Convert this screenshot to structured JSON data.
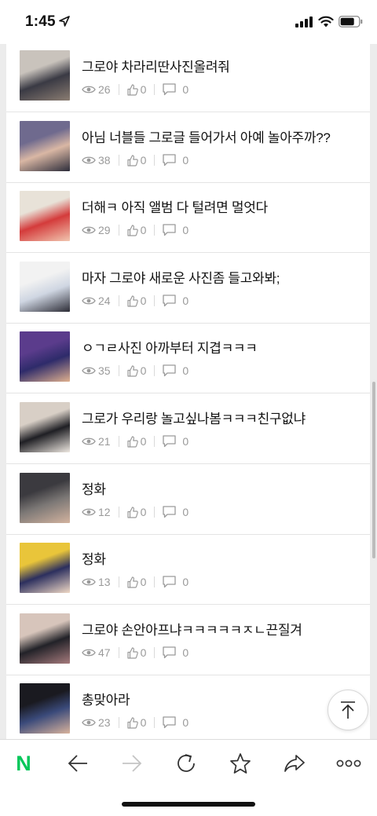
{
  "status_bar": {
    "time": "1:45"
  },
  "posts": [
    {
      "title": "그로야 차라리딴사진올려줘",
      "views": "26",
      "likes": "0",
      "comments": "0",
      "thumb_colors": [
        "#c9c3bc",
        "#3a3a44",
        "#8b7d72"
      ]
    },
    {
      "title": "아님 너블들 그로글 들어가서 아예 놀아주까??",
      "views": "38",
      "likes": "0",
      "comments": "0",
      "thumb_colors": [
        "#6f6a8e",
        "#d9b7a4",
        "#2c2c3a"
      ]
    },
    {
      "title": "더해ㅋ 아직 앨범 다 털려면 멀엇다",
      "views": "29",
      "likes": "0",
      "comments": "0",
      "thumb_colors": [
        "#e8e2d8",
        "#d43b3b",
        "#f1c6b0"
      ]
    },
    {
      "title": "마자 그로야 새로운 사진좀 들고와봐;",
      "views": "24",
      "likes": "0",
      "comments": "0",
      "thumb_colors": [
        "#f2f2f2",
        "#cfd6e2",
        "#2b2b35"
      ]
    },
    {
      "title": "ㅇㄱㄹ사진 아까부터 지겹ㅋㅋㅋ",
      "views": "35",
      "likes": "0",
      "comments": "0",
      "thumb_colors": [
        "#5b3c8c",
        "#2e2b6a",
        "#e0b08e"
      ]
    },
    {
      "title": "그로가 우리랑 놀고싶나봄ㅋㅋㅋ친구없냐",
      "views": "21",
      "likes": "0",
      "comments": "0",
      "thumb_colors": [
        "#d8cfc6",
        "#1f1f24",
        "#efe9e2"
      ]
    },
    {
      "title": "정화",
      "views": "12",
      "likes": "0",
      "comments": "0",
      "thumb_colors": [
        "#3b3a3f",
        "#7b7775",
        "#d3b39f"
      ]
    },
    {
      "title": "정화",
      "views": "13",
      "likes": "0",
      "comments": "0",
      "thumb_colors": [
        "#e9c53a",
        "#2c2f5e",
        "#f0d9c6"
      ]
    },
    {
      "title": "그로야 손안아프냐ㅋㅋㅋㅋㅋㅈㄴ끈질겨",
      "views": "47",
      "likes": "0",
      "comments": "0",
      "thumb_colors": [
        "#d7c5bb",
        "#222228",
        "#a67b7d"
      ]
    },
    {
      "title": "총맞아라",
      "views": "23",
      "likes": "0",
      "comments": "0",
      "thumb_colors": [
        "#1a1a20",
        "#3a4a7a",
        "#d9b39c"
      ]
    }
  ],
  "toolbar": {
    "logo": "N",
    "icons": [
      "naver-logo",
      "back-arrow-icon",
      "forward-arrow-icon",
      "refresh-icon",
      "star-icon",
      "share-icon",
      "more-icon"
    ],
    "accent": "#03c75a"
  },
  "scroll_top_icon": "arrow-up-icon"
}
